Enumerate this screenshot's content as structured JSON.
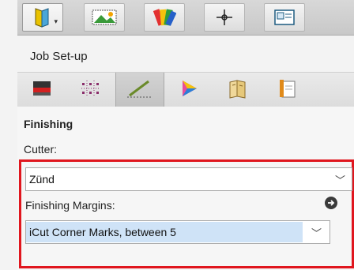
{
  "toolbar_top": {
    "items": [
      {
        "name": "document-icon",
        "has_dropdown": true
      },
      {
        "name": "image-layout-icon"
      },
      {
        "name": "color-swatches-icon"
      },
      {
        "name": "crosshair-icon"
      },
      {
        "name": "display-icon"
      }
    ]
  },
  "section": {
    "label": "Job Set-up"
  },
  "toolbar_second": {
    "items": [
      {
        "name": "printer-icon"
      },
      {
        "name": "grid-dots-icon"
      },
      {
        "name": "knife-icon",
        "selected": true
      },
      {
        "name": "color-triangle-icon"
      },
      {
        "name": "book-icon"
      },
      {
        "name": "document-stack-icon"
      }
    ]
  },
  "panel": {
    "title": "Finishing",
    "cutter_label": "Cutter:",
    "cutter_value": "Zünd",
    "margins_label": "Finishing Margins:",
    "margins_value": "iCut Corner Marks, between 5",
    "highlight_color": "#e0161e",
    "selection_color": "#cfe3f7"
  }
}
